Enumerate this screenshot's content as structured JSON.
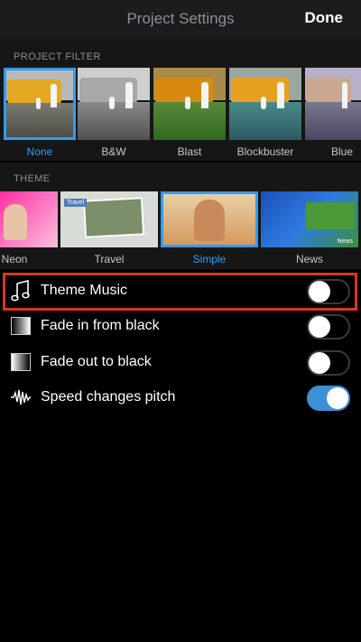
{
  "header": {
    "title": "Project Settings",
    "done_label": "Done"
  },
  "project_filter": {
    "section_label": "PROJECT FILTER",
    "items": [
      {
        "label": "None",
        "selected": true
      },
      {
        "label": "B&W",
        "selected": false
      },
      {
        "label": "Blast",
        "selected": false
      },
      {
        "label": "Blockbuster",
        "selected": false
      },
      {
        "label": "Blue",
        "selected": false
      }
    ]
  },
  "theme": {
    "section_label": "THEME",
    "items": [
      {
        "label": "Neon",
        "selected": false
      },
      {
        "label": "Travel",
        "selected": false
      },
      {
        "label": "Simple",
        "selected": true
      },
      {
        "label": "News",
        "selected": false
      }
    ],
    "travel_tag": "Travel",
    "news_tag": "News"
  },
  "settings": [
    {
      "label": "Theme Music",
      "icon": "music-note-icon",
      "on": false,
      "highlighted": true
    },
    {
      "label": "Fade in from black",
      "icon": "fade-in-icon",
      "on": false
    },
    {
      "label": "Fade out to black",
      "icon": "fade-out-icon",
      "on": false
    },
    {
      "label": "Speed changes pitch",
      "icon": "waveform-icon",
      "on": true
    }
  ],
  "colors": {
    "accent": "#2f9cf5",
    "toggle_on": "#3d8fd6",
    "highlight": "#d8381f"
  }
}
